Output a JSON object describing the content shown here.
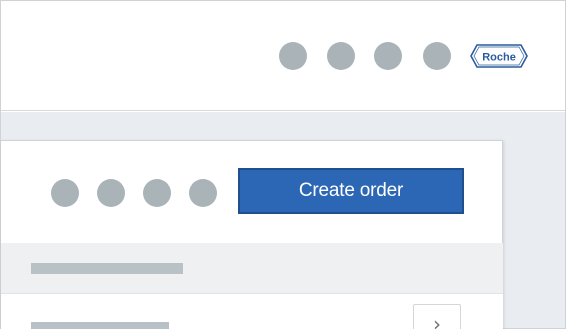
{
  "header": {
    "logo_text": "Roche",
    "nav_icons": [
      "placeholder-circle",
      "placeholder-circle",
      "placeholder-circle",
      "placeholder-circle"
    ]
  },
  "card": {
    "action_icons": [
      "placeholder-circle",
      "placeholder-circle",
      "placeholder-circle",
      "placeholder-circle"
    ],
    "create_order_label": "Create order",
    "next_icon": "chevron-right-icon",
    "next_glyph": "›"
  },
  "colors": {
    "accent": "#2c67b5",
    "placeholder": "#a9b3b8",
    "page_background": "#e9edf1"
  }
}
